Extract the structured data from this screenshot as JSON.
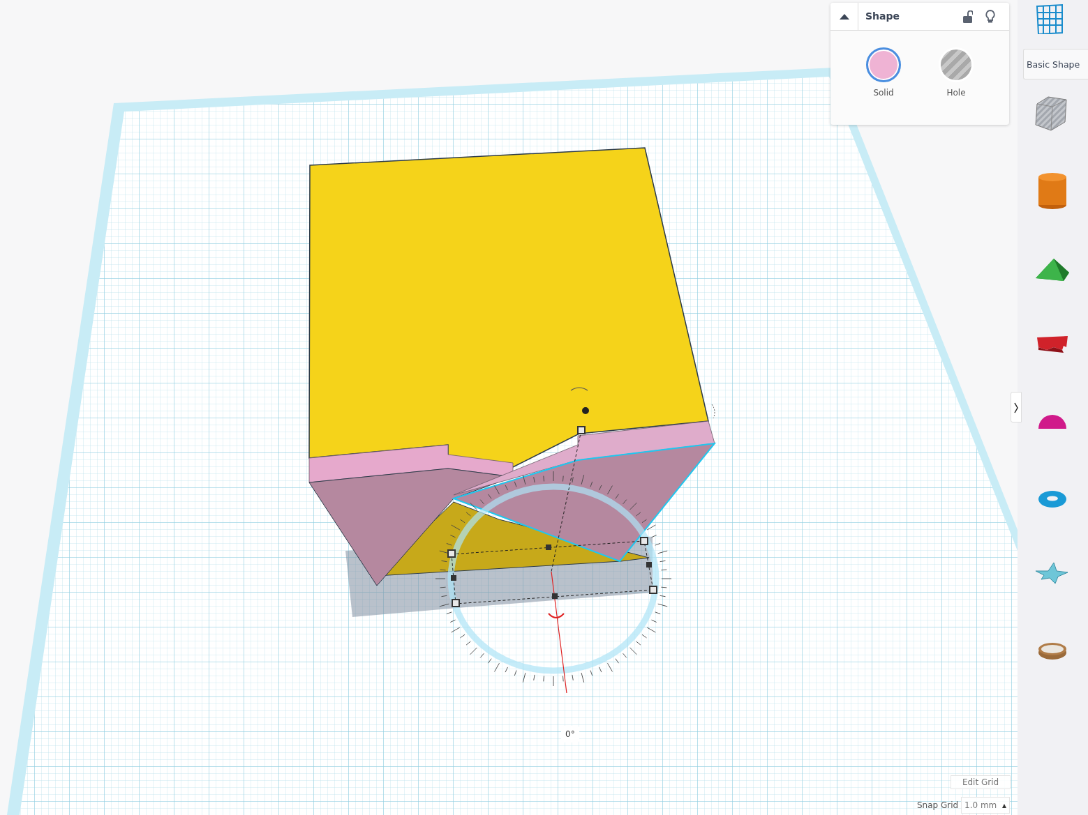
{
  "shape_panel": {
    "title": "Shape",
    "options": [
      {
        "label": "Solid",
        "kind": "solid",
        "selected": true
      },
      {
        "label": "Hole",
        "kind": "hole",
        "selected": false
      }
    ]
  },
  "library": {
    "category": "Basic Shape",
    "shapes": [
      {
        "kind": "box"
      },
      {
        "kind": "cylinder"
      },
      {
        "kind": "roof"
      },
      {
        "kind": "text"
      },
      {
        "kind": "half-sphere"
      },
      {
        "kind": "torus"
      },
      {
        "kind": "star"
      },
      {
        "kind": "tube"
      }
    ]
  },
  "rotation": {
    "reading": "0°"
  },
  "grid": {
    "edit_label": "Edit Grid",
    "snap_label": "Snap Grid",
    "snap_value": "1.0 mm",
    "caret": "▴"
  }
}
